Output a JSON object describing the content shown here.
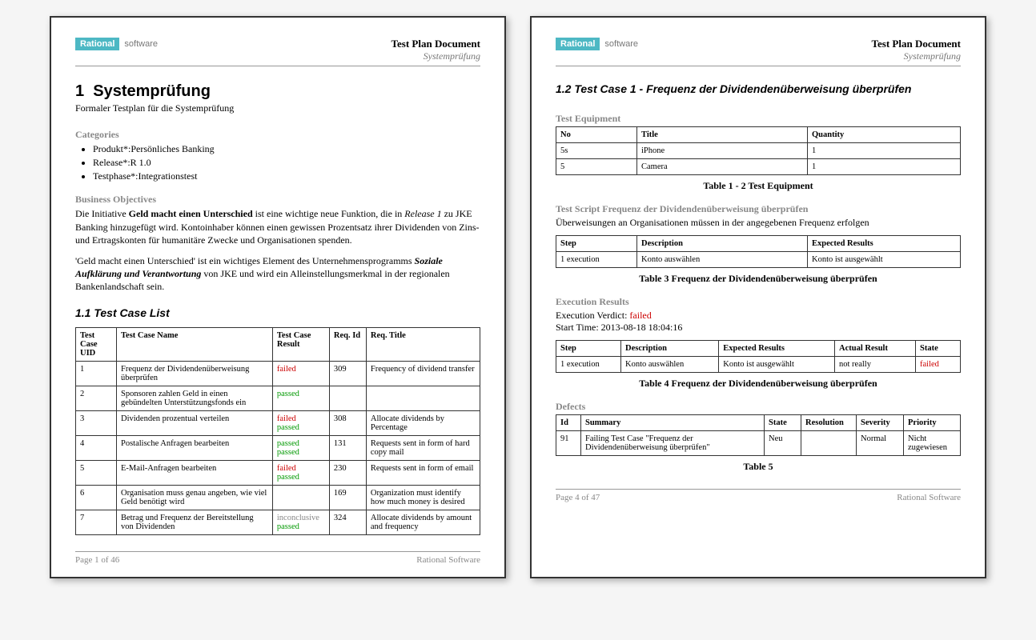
{
  "header": {
    "logo_left": "Rational",
    "logo_right": "software",
    "doc_title": "Test Plan Document",
    "doc_subtitle": "Systemprüfung"
  },
  "page1": {
    "section_num": "1",
    "section_title": "Systemprüfung",
    "plan_subtitle": "Formaler Testplan für die Systemprüfung",
    "categories_label": "Categories",
    "categories": [
      "Produkt*:Persönliches Banking",
      "Release*:R 1.0",
      "Testphase*:Integrationstest"
    ],
    "objectives_label": "Business Objectives",
    "para1_a": "Die Initiative ",
    "para1_b": "Geld macht einen Unterschied",
    "para1_c": " ist eine wichtige neue Funktion, die in ",
    "para1_d": "Release 1",
    "para1_e": " zu JKE Banking hinzugefügt wird. Kontoinhaber können einen gewissen Prozentsatz ihrer Dividenden von Zins- und Ertragskonten für humanitäre Zwecke und Organisationen spenden.",
    "para2_a": "'Geld macht einen Unterschied' ist ein wichtiges Element des Unternehmensprogramms ",
    "para2_b": "Soziale Aufklärung und Verantwortung",
    "para2_c": " von JKE und wird ein Alleinstellungsmerkmal in der regionalen Bankenlandschaft sein.",
    "subsection": "1.1  Test Case List",
    "table_headers": {
      "uid": "Test Case UID",
      "name": "Test Case Name",
      "result": "Test Case Result",
      "reqid": "Req. Id",
      "reqtitle": "Req. Title"
    },
    "rows": [
      {
        "uid": "1",
        "name": "Frequenz der Dividendenüberweisung überprüfen",
        "results": [
          {
            "t": "failed",
            "c": "failed"
          }
        ],
        "reqid": "309",
        "reqtitle": "Frequency of dividend transfer"
      },
      {
        "uid": "2",
        "name": "Sponsoren zahlen Geld in einen gebündelten Unterstützungsfonds ein",
        "results": [
          {
            "t": "passed",
            "c": "passed"
          }
        ],
        "reqid": "",
        "reqtitle": ""
      },
      {
        "uid": "3",
        "name": "Dividenden prozentual verteilen",
        "results": [
          {
            "t": "failed",
            "c": "failed"
          },
          {
            "t": "passed",
            "c": "passed"
          }
        ],
        "reqid": "308",
        "reqtitle": "Allocate dividends by Percentage"
      },
      {
        "uid": "4",
        "name": "Postalische Anfragen bearbeiten",
        "results": [
          {
            "t": "passed",
            "c": "passed"
          },
          {
            "t": "passed",
            "c": "passed"
          }
        ],
        "reqid": "131",
        "reqtitle": "Requests sent in form of hard copy mail"
      },
      {
        "uid": "5",
        "name": "E-Mail-Anfragen bearbeiten",
        "results": [
          {
            "t": "failed",
            "c": "failed"
          },
          {
            "t": "passed",
            "c": "passed"
          }
        ],
        "reqid": "230",
        "reqtitle": "Requests sent in form of email"
      },
      {
        "uid": "6",
        "name": "Organisation muss genau angeben, wie viel Geld benötigt wird",
        "results": [],
        "reqid": "169",
        "reqtitle": "Organization must identify how much money is desired"
      },
      {
        "uid": "7",
        "name": "Betrag und Frequenz der Bereitstellung von Dividenden",
        "results": [
          {
            "t": "inconclusive",
            "c": "inconclusive"
          },
          {
            "t": "passed",
            "c": "passed"
          }
        ],
        "reqid": "324",
        "reqtitle": "Allocate dividends by amount and frequency"
      }
    ],
    "footer_left": "Page 1 of  46",
    "footer_right": "Rational Software"
  },
  "page4": {
    "subsection": "1.2  Test Case 1 - Frequenz der Dividendenüberweisung überprüfen",
    "equip_label": "Test Equipment",
    "equip_headers": {
      "no": "No",
      "title": "Title",
      "qty": "Quantity"
    },
    "equip_rows": [
      {
        "no": "5s",
        "title": "iPhone",
        "qty": "1"
      },
      {
        "no": "5",
        "title": "Camera",
        "qty": "1"
      }
    ],
    "equip_caption": "Table 1 - 2 Test Equipment",
    "script_label_a": "Test Script ",
    "script_label_b": "Frequenz der Dividendenüberweisung überprüfen",
    "script_desc": "Überweisungen an Organisationen müssen in der angegebenen Frequenz erfolgen",
    "script_headers": {
      "step": "Step",
      "desc": "Description",
      "exp": "Expected Results"
    },
    "script_rows": [
      {
        "step": "1 execution",
        "desc": "Konto auswählen",
        "exp": "Konto ist ausgewählt"
      }
    ],
    "script_caption": "Table 3 Frequenz der Dividendenüberweisung überprüfen",
    "exec_label": "Execution Results",
    "exec_verdict_label": "Execution Verdict: ",
    "exec_verdict": "failed",
    "exec_time": "Start Time: 2013-08-18 18:04:16",
    "exec_headers": {
      "step": "Step",
      "desc": "Description",
      "exp": "Expected Results",
      "actual": "Actual Result",
      "state": "State"
    },
    "exec_rows": [
      {
        "step": "1 execution",
        "desc": "Konto auswählen",
        "exp": "Konto ist ausgewählt",
        "actual": "not really",
        "state": "failed"
      }
    ],
    "exec_caption": "Table 4 Frequenz der Dividendenüberweisung überprüfen",
    "defects_label": "Defects",
    "defects_headers": {
      "id": "Id",
      "summary": "Summary",
      "state": "State",
      "resolution": "Resolution",
      "severity": "Severity",
      "priority": "Priority"
    },
    "defects_rows": [
      {
        "id": "91",
        "summary": "Failing Test Case \"Frequenz der Dividendenüberweisung überprüfen\"",
        "state": "Neu",
        "resolution": "",
        "severity": "Normal",
        "priority": "Nicht zugewiesen"
      }
    ],
    "defects_caption": "Table 5",
    "footer_left": "Page 4 of  47",
    "footer_right": "Rational Software"
  }
}
